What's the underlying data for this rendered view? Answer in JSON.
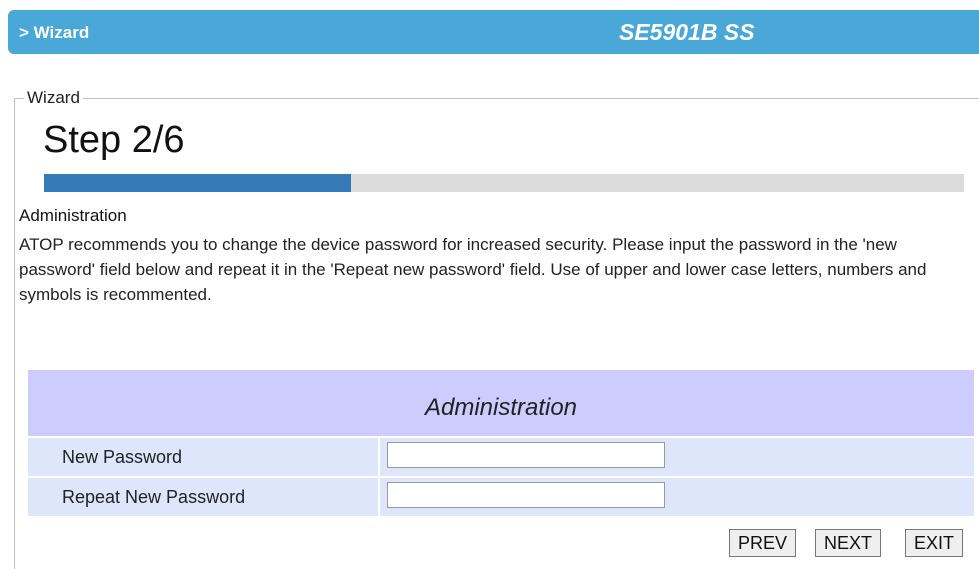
{
  "header": {
    "breadcrumb": "> Wizard",
    "device_name": "SE5901B SS"
  },
  "wizard": {
    "legend": "Wizard",
    "step_title": "Step 2/6",
    "progress": {
      "current_step": 2,
      "total_steps": 6,
      "fraction": 0.333
    },
    "section_label": "Administration",
    "description": "ATOP recommends you to change the device password for increased security. Please input the password in the 'new password' field below and repeat it in the 'Repeat new password' field. Use of upper and lower case letters, numbers and symbols is recommented."
  },
  "admin_table": {
    "title": "Administration",
    "rows": [
      {
        "label": "New Password",
        "value": ""
      },
      {
        "label": "Repeat New Password",
        "value": ""
      }
    ]
  },
  "buttons": {
    "prev": "PREV",
    "next": "NEXT",
    "exit": "EXIT"
  },
  "colors": {
    "header_bar": "#4aa8d8",
    "progress_fill": "#337ab7",
    "progress_track": "#dcdcdc",
    "table_header": "#ccccff",
    "table_row": "#dde6fb"
  }
}
